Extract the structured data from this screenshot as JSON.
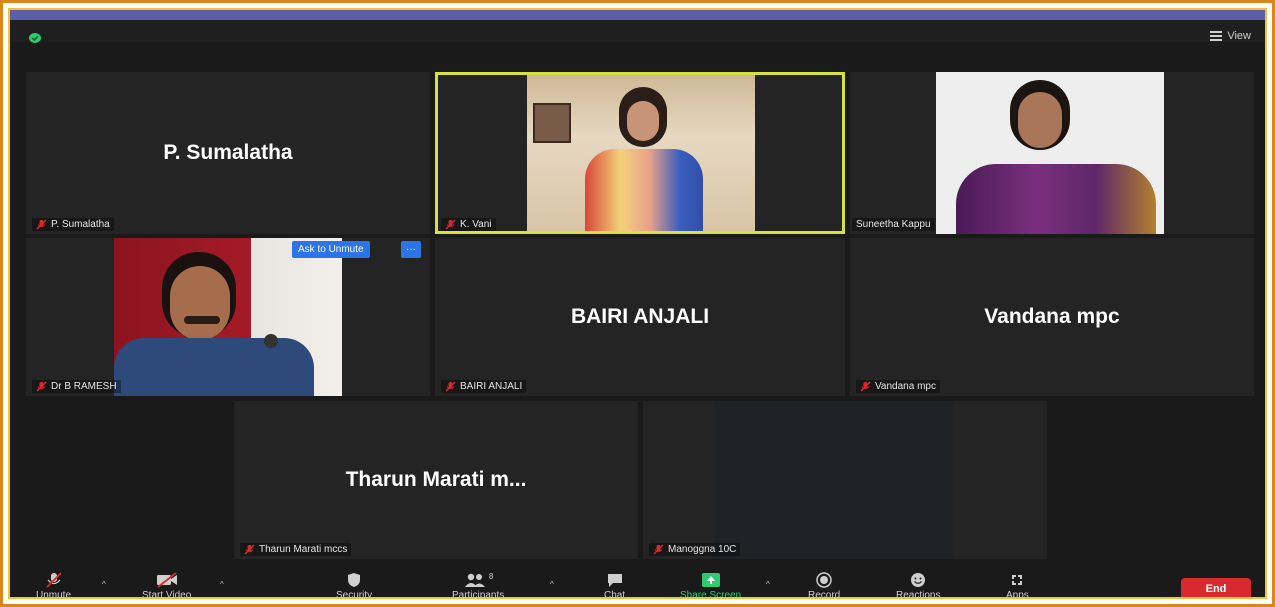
{
  "topbar": {
    "view_label": "View"
  },
  "tiles": [
    {
      "name": "P. Sumalatha",
      "label": "P. Sumalatha"
    },
    {
      "label": "K. Vani"
    },
    {
      "label": "Suneetha Kappu"
    },
    {
      "label": "Dr B RAMESH",
      "ask_unmute": "Ask to Unmute",
      "more": "···"
    },
    {
      "name": "BAIRI ANJALI",
      "label": "BAIRI ANJALI"
    },
    {
      "name": "Vandana mpc",
      "label": "Vandana mpc"
    },
    {
      "name": "Tharun Marati m...",
      "label": "Tharun Marati mccs"
    },
    {
      "label": "Manoggna 10C"
    }
  ],
  "toolbar": {
    "unmute": "Unmute",
    "start_video": "Start Video",
    "security": "Security",
    "participants": "Participants",
    "participants_count": "8",
    "chat": "Chat",
    "share_screen": "Share Screen",
    "record": "Record",
    "reactions": "Reactions",
    "apps": "Apps",
    "end": "End"
  },
  "colors": {
    "frame_outer": "#d9861c",
    "frame_inner": "#f2c23b",
    "active_speaker": "#d7e23a",
    "share_green": "#2ecc71",
    "end_red": "#d8292f",
    "ask_blue": "#2d74e8"
  }
}
